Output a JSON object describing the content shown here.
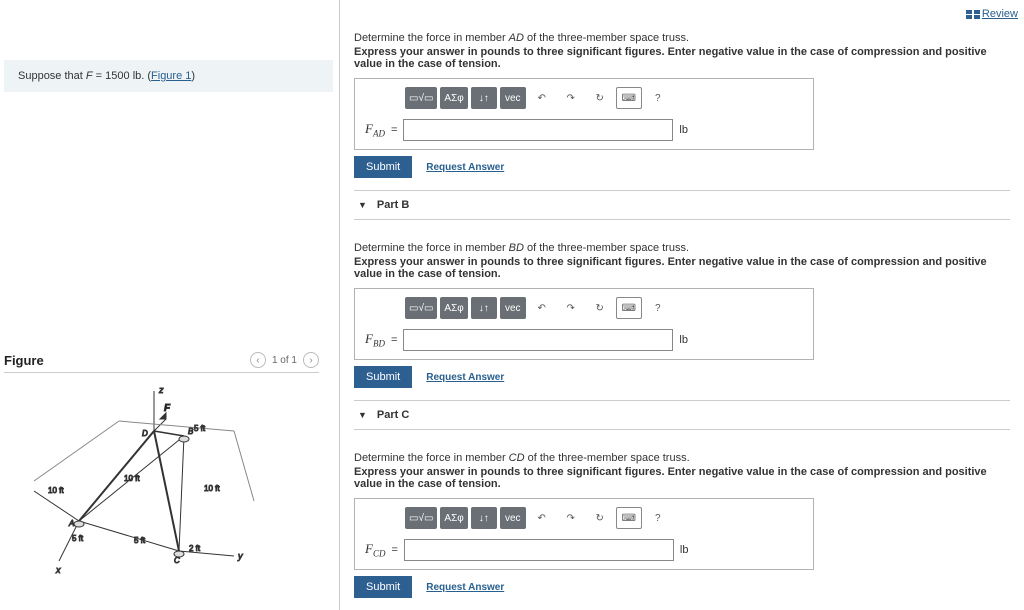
{
  "review_label": "Review",
  "suppose": {
    "prefix": "Suppose that ",
    "var": "F",
    "eq": " = 1500 lb. (",
    "link": "Figure 1",
    "suffix": ")"
  },
  "figure": {
    "title": "Figure",
    "counter": "1 of 1",
    "labels": {
      "F": "F",
      "z": "z",
      "x": "x",
      "y": "y",
      "A": "A",
      "B": "B",
      "C": "C",
      "D": "D",
      "d5a": "5 ft",
      "d5b": "5 ft",
      "d5c": "5 ft",
      "d10a": "10 ft",
      "d10b": "10 ft",
      "d10c": "10 ft",
      "d2": "2 ft"
    }
  },
  "parts": [
    {
      "id": "A",
      "member": "AD",
      "var_html": "F<sub>AD</sub>"
    },
    {
      "id": "B",
      "member": "BD",
      "var_html": "F<sub>BD</sub>",
      "header": "Part B"
    },
    {
      "id": "C",
      "member": "CD",
      "var_html": "F<sub>CD</sub>",
      "header": "Part C"
    }
  ],
  "q_prefix": "Determine the force in member ",
  "q_suffix": " of the three-member space truss.",
  "instruction": "Express your answer in pounds to three significant figures. Enter negative value in the case of compression and positive value in the case of tension.",
  "unit": "lb",
  "submit": "Submit",
  "request": "Request Answer",
  "toolbar": {
    "sqrt": "√",
    "greek": "ΑΣφ",
    "updown": "↓↑",
    "vec": "vec",
    "undo": "↶",
    "redo": "↷",
    "reset": "↻",
    "help": "?"
  },
  "eq": " = "
}
